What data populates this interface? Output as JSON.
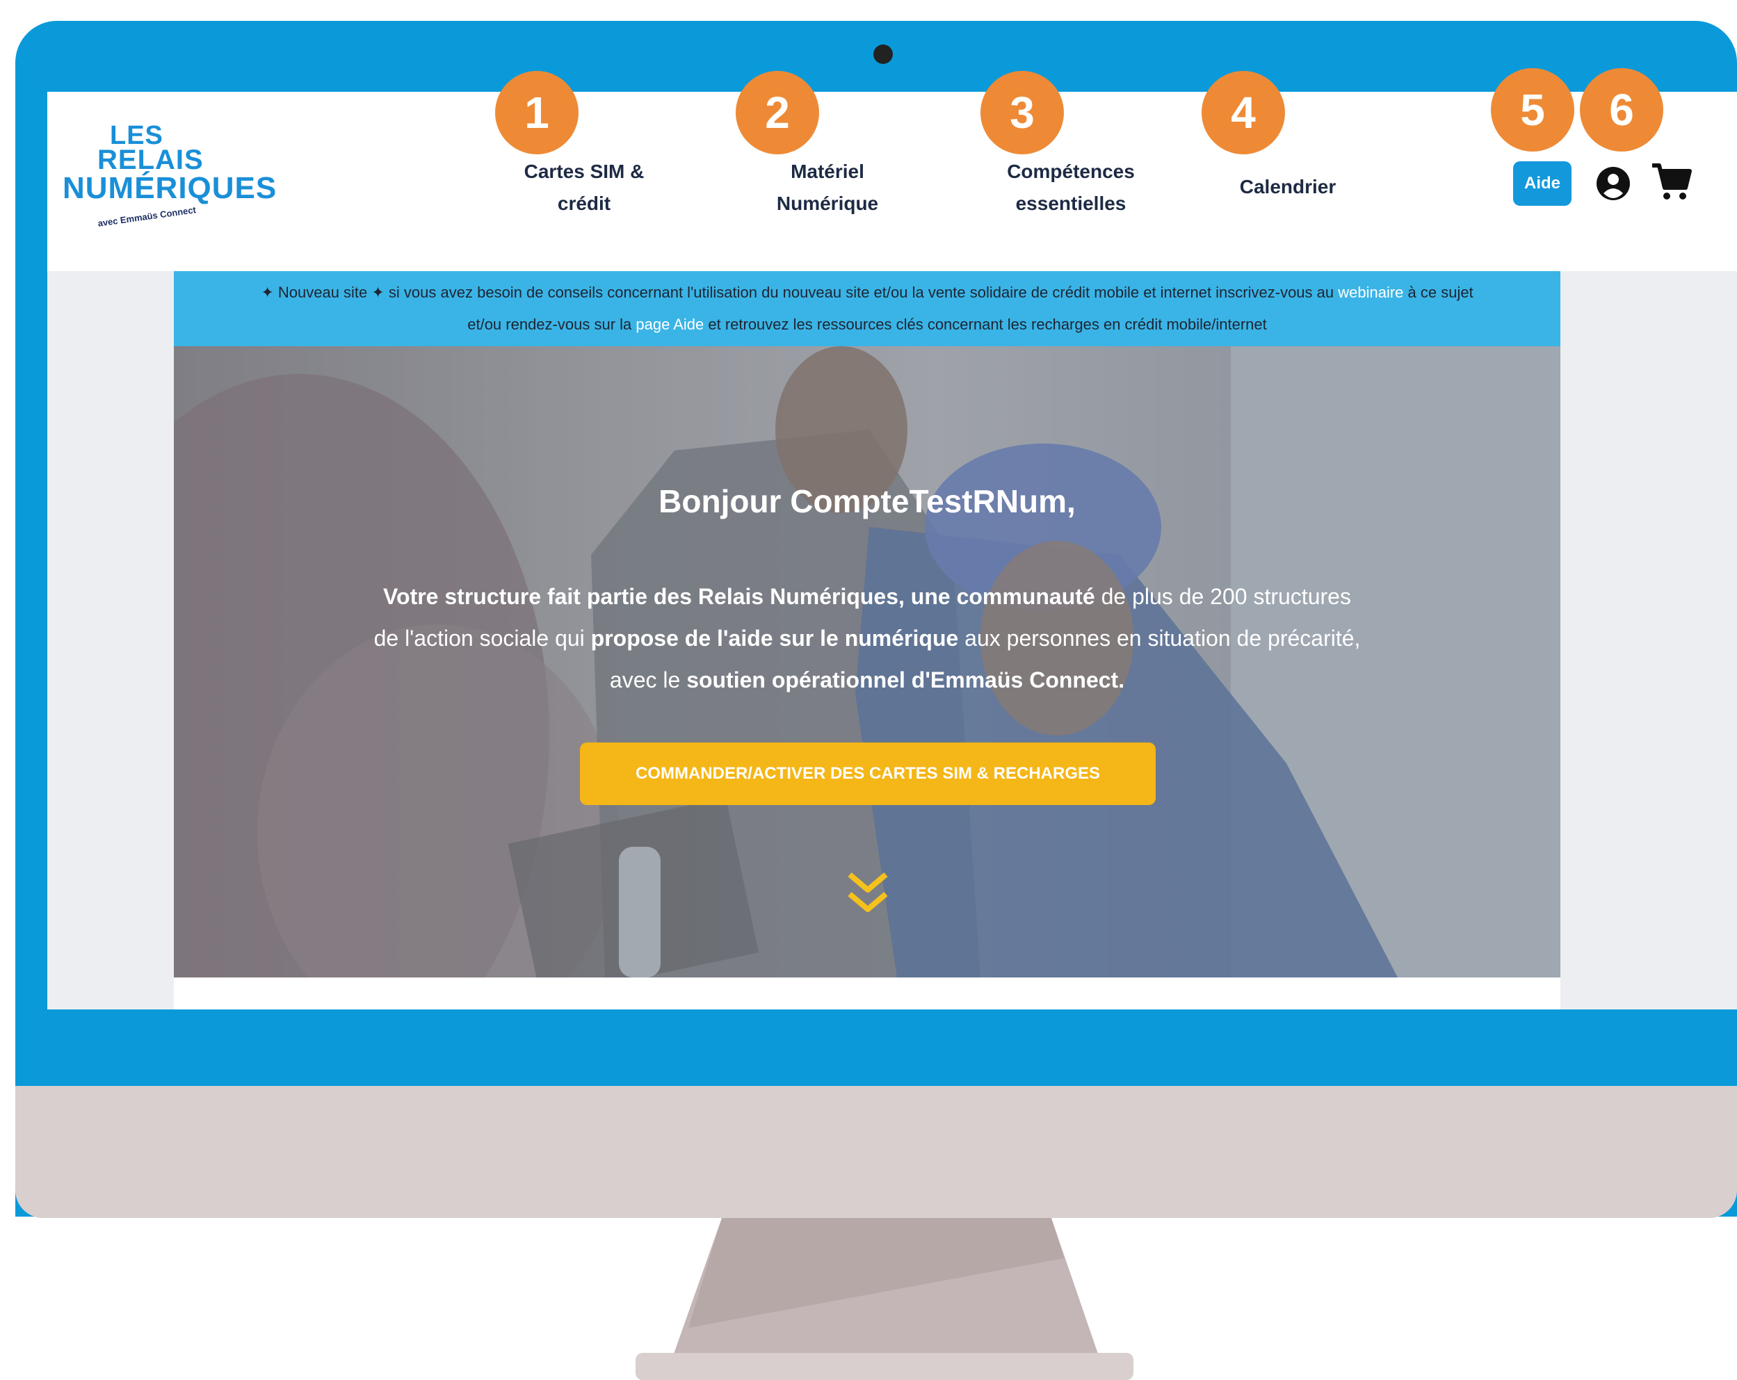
{
  "header": {
    "logo": {
      "line1": "LES",
      "line2": "RELAIS",
      "line3": "NUMÉRIQUES",
      "tagline": "avec Emmaüs Connect"
    },
    "nav": [
      {
        "number": "1",
        "line1": "Cartes SIM &",
        "line2": "crédit"
      },
      {
        "number": "2",
        "line1": "Matériel",
        "line2": "Numérique"
      },
      {
        "number": "3",
        "line1": "Compétences",
        "line2": "essentielles"
      },
      {
        "number": "4",
        "line1": "Calendrier",
        "line2": ""
      }
    ],
    "aide_button": "Aide",
    "aide_badge": "5",
    "account_badge": "6",
    "icons": [
      "user-circle-icon",
      "cart-icon"
    ]
  },
  "notice": {
    "part1": "✦ Nouveau site ✦ si vous avez besoin de conseils concernant l'utilisation du nouveau site et/ou la vente solidaire de crédit mobile et internet inscrivez-vous au ",
    "link1": "webinaire",
    "part2": " à ce sujet",
    "part3": "et/ou rendez-vous sur la ",
    "link2": "page Aide",
    "part4": " et retrouvez les ressources clés concernant les recharges en crédit mobile/internet"
  },
  "hero": {
    "title": "Bonjour CompteTestRNum,",
    "p1_bold": "Votre structure fait partie des Relais Numériques, une communauté",
    "p1_rest": " de plus de 200 structures",
    "p2_start": "de l'action sociale qui ",
    "p2_bold": "propose de l'aide sur le numérique",
    "p2_end": " aux personnes en situation de précarité,",
    "p3_start": "avec le ",
    "p3_bold": "soutien opérationnel d'Emmaüs Connect.",
    "cta": "COMMANDER/ACTIVER DES CARTES SIM & RECHARGES"
  },
  "colors": {
    "bezel": "#0b9ad9",
    "badge": "#ee8a35",
    "cta": "#f5b617",
    "banner": "#3ab4e6",
    "aide": "#1498dc"
  }
}
